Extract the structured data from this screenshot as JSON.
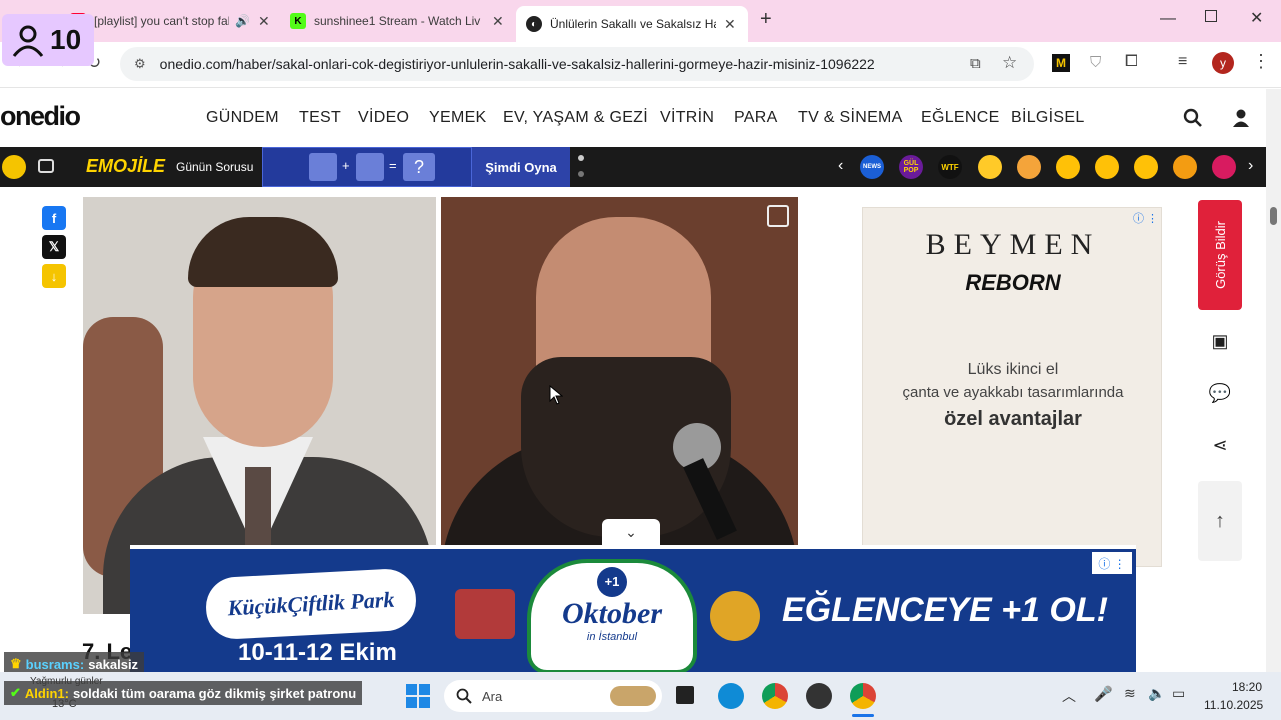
{
  "browser": {
    "tabs": [
      {
        "title": "[playlist] you can't stop falli",
        "favicon": "youtube-icon",
        "active": false
      },
      {
        "title": "sunshinee1 Stream - Watch Liv",
        "favicon": "kick-icon",
        "active": false
      },
      {
        "title": "Ünlülerin Sakallı ve Sakalsız Hal",
        "favicon": "onedio-icon",
        "active": true
      }
    ],
    "new_tab": "+",
    "url": "onedio.com/haber/sakal-onlari-cok-degistiriyor-unlulerin-sakalli-ve-sakalsiz-hallerini-gormeye-hazir-misiniz-1096222",
    "profile_initial": "y"
  },
  "overlay": {
    "viewer_count": "10"
  },
  "site": {
    "logo": "onedio",
    "nav": [
      "GÜNDEM",
      "TEST",
      "VİDEO",
      "YEMEK",
      "EV, YAŞAM & GEZİ",
      "VİTRİN",
      "PARA",
      "TV & SİNEMA",
      "EĞLENCE",
      "BİLGİSEL"
    ]
  },
  "emoji_bar": {
    "brand": "EMOJİLE",
    "question_label": "Günün Sorusu",
    "question_mark": "?",
    "play_label": "Şimdi Oyna",
    "chip_labels": [
      "NEWS",
      "GÜL POP",
      "WTF"
    ]
  },
  "article": {
    "heading_partial": "7. Le"
  },
  "side_ad": {
    "brand": "BEYMEN",
    "sub": "REBORN",
    "line1": "Lüks ikinci el",
    "line2": "çanta ve ayakkabı tasarımlarında",
    "line3": "özel avantajlar"
  },
  "feedback_button": "Görüş Bildir",
  "banner_ad": {
    "park_name": "KüçükÇiftlik Park",
    "dates": "10-11-12 Ekim",
    "logo_plus": "+1",
    "logo_main": "Oktober",
    "logo_sub": "in İstanbul",
    "slogan": "EĞLENCEYE +1 OL!"
  },
  "chat": [
    {
      "user": "busrams:",
      "text": "sakalsiz"
    },
    {
      "user": "Aldin1:",
      "text": "soldaki tüm oarama göz dikmiş şirket patronu"
    }
  ],
  "weather": {
    "label": "Yağmurlu günler",
    "temp": "13°C"
  },
  "taskbar": {
    "search_placeholder": "Ara",
    "time": "18:20",
    "date": "11.10.2025"
  },
  "colors": {
    "tabstrip": "#f9d7ec",
    "emoji_bar": "#1a1a1a",
    "banner": "#143a8c",
    "feedback": "#e0213a"
  }
}
